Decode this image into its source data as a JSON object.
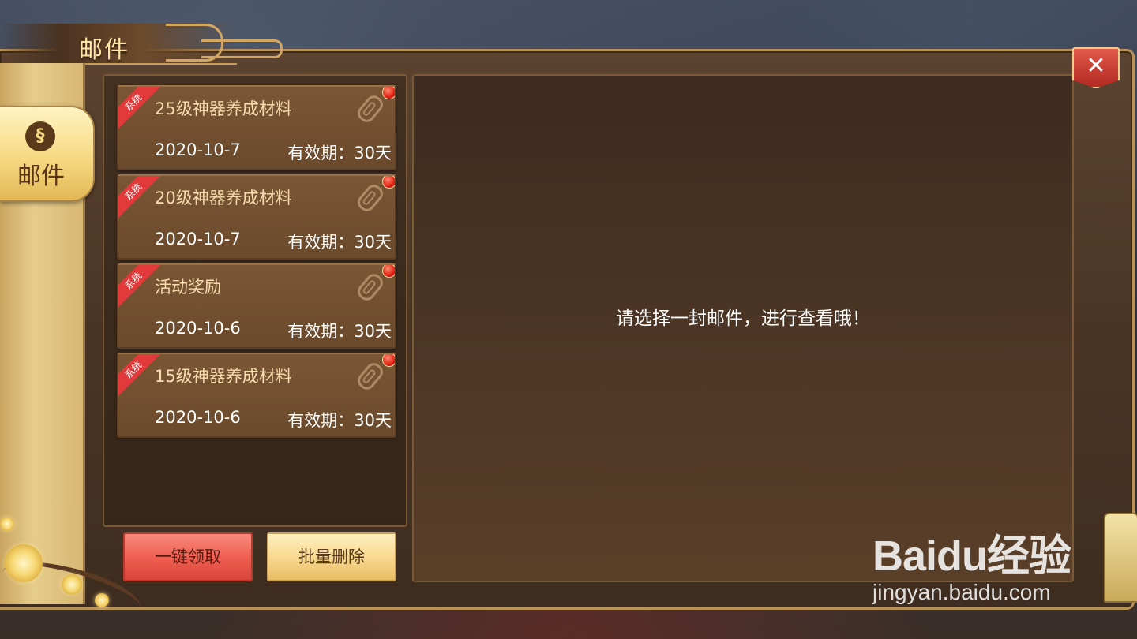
{
  "window": {
    "title": "邮件"
  },
  "sidebar": {
    "tabs": [
      {
        "label": "邮件",
        "icon": "mail-icon",
        "active": true
      }
    ]
  },
  "mail_list": [
    {
      "tag": "系统",
      "title": "25级神器养成材料",
      "date": "2020-10-7",
      "expiry": "有效期：30天",
      "has_attachment": true,
      "unread": true
    },
    {
      "tag": "系统",
      "title": "20级神器养成材料",
      "date": "2020-10-7",
      "expiry": "有效期：30天",
      "has_attachment": true,
      "unread": true
    },
    {
      "tag": "系统",
      "title": "活动奖励",
      "date": "2020-10-6",
      "expiry": "有效期：30天",
      "has_attachment": true,
      "unread": true
    },
    {
      "tag": "系统",
      "title": "15级神器养成材料",
      "date": "2020-10-6",
      "expiry": "有效期：30天",
      "has_attachment": true,
      "unread": true
    }
  ],
  "buttons": {
    "claim_all": "一键领取",
    "batch_delete": "批量删除",
    "close": "✕"
  },
  "detail": {
    "empty_message": "请选择一封邮件，进行查看哦！"
  },
  "watermark": {
    "logo": "Baidu经验",
    "url": "jingyan.baidu.com"
  },
  "colors": {
    "accent_gold": "#f6d982",
    "unread_red": "#e01e10",
    "ribbon_red": "#e23a3a",
    "claim_button": "#ee5d50"
  }
}
